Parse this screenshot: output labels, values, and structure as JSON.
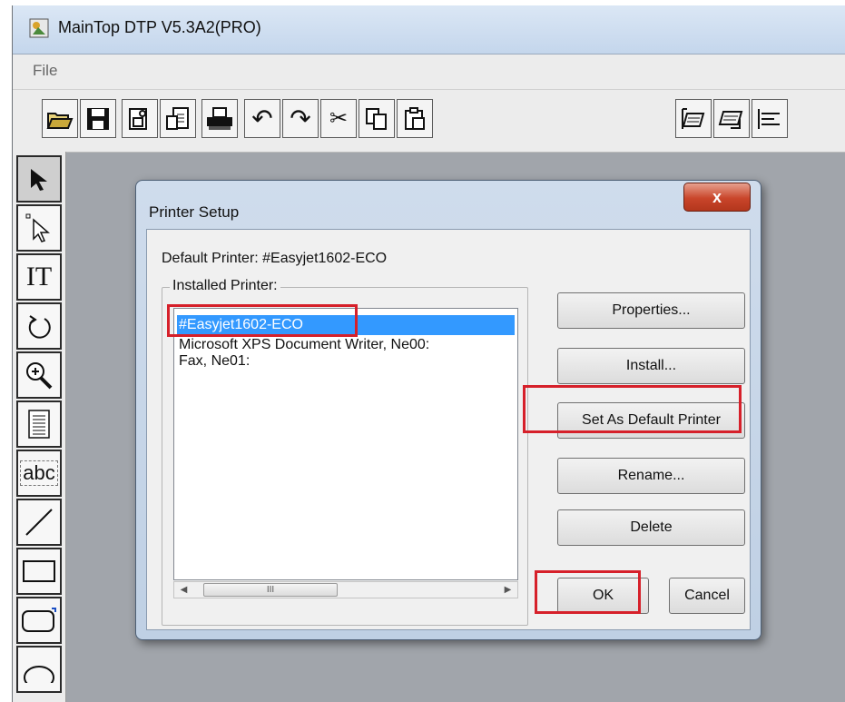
{
  "app": {
    "title": "MainTop DTP V5.3A2(PRO)",
    "menu": [
      "File"
    ]
  },
  "toolbar": {
    "icons": [
      "open-icon",
      "save-icon",
      "import-icon",
      "export-icon",
      "print-icon",
      "undo-icon",
      "redo-icon",
      "cut-icon",
      "copy-icon",
      "paste-icon",
      "align-icon",
      "align2-icon",
      "align3-icon"
    ]
  },
  "toolbox": {
    "tools": [
      "select-arrow-icon",
      "node-select-icon",
      "text-tool-icon",
      "rotate-icon",
      "zoom-icon",
      "paragraph-icon",
      "text-frame-icon",
      "line-icon",
      "rectangle-icon",
      "rounded-rectangle-icon",
      "ellipse-icon"
    ],
    "text_tool_label": "IT",
    "text_frame_label": "abc"
  },
  "dialog": {
    "title": "Printer Setup",
    "close_label": "x",
    "default_printer_label": "Default Printer: #Easyjet1602-ECO",
    "installed_label": "Installed Printer:",
    "printers": [
      "#Easyjet1602-ECO",
      "Microsoft XPS Document Writer, Ne00:",
      "Fax, Ne01:"
    ],
    "selected_index": 0,
    "scroll_thumb_label": "III",
    "buttons": {
      "properties": "Properties...",
      "install": "Install...",
      "set_default": "Set As Default Printer",
      "rename": "Rename...",
      "delete": "Delete",
      "ok": "OK",
      "cancel": "Cancel"
    }
  },
  "colors": {
    "highlight_box": "#d6202a",
    "selection": "#3399ff"
  }
}
